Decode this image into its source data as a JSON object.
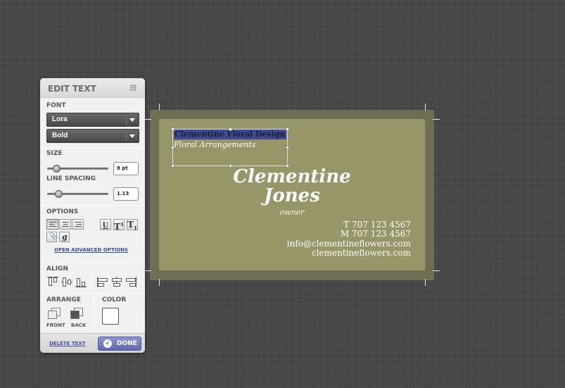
{
  "panel": {
    "title": "EDIT TEXT",
    "font_label": "FONT",
    "font_value": "Lora",
    "style_value": "Bold",
    "size_label": "SIZE",
    "size_value": "8 pt",
    "size_slider_fraction": 0.1,
    "spacing_label": "LINE SPACING",
    "spacing_value": "1.13",
    "spacing_slider_fraction": 0.15,
    "options_label": "OPTIONS",
    "format_buttons": [
      "U",
      "T",
      "T"
    ],
    "advanced_link": "OPEN ADVANCED OPTIONS",
    "align_label": "ALIGN",
    "arrange_label": "ARRANGE",
    "front_label": "FRONT",
    "back_label": "BACK",
    "color_label": "COLOR",
    "color_value": "#ffffff",
    "delete_label": "DELETE TEXT",
    "done_label": "DONE"
  },
  "card": {
    "company": "Clementine Floral Design",
    "subtitle": "Floral Arrangements",
    "first_name": "Clementine",
    "last_name": "Jones",
    "role": "owner",
    "phone": "T 707 123 4567",
    "mobile": "M 707 123 4567",
    "email": "info@clementineflowers.com",
    "website": "clementineflowers.com",
    "card_color": "#979668",
    "bleed_color": "#6f6e52",
    "highlight_color": "#3d4a92"
  }
}
